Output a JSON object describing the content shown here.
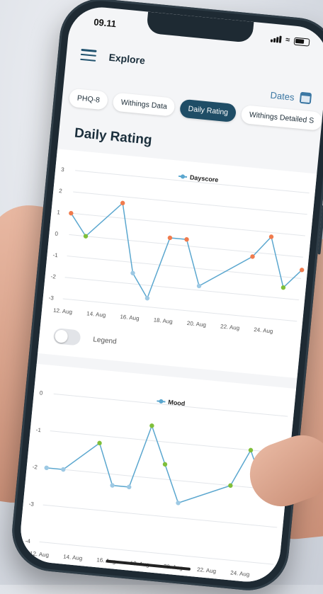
{
  "status": {
    "time": "09.11"
  },
  "header": {
    "title": "Explore",
    "dates_label": "Dates"
  },
  "tabs": [
    "PHQ-8",
    "Withings Data",
    "Daily Rating",
    "Withings Detailed S"
  ],
  "active_tab": "Daily Rating",
  "section_title": "Daily Rating",
  "legend_toggle_label": "Legend",
  "colors": {
    "line": "#5ba7cf",
    "red": "#f07b4d",
    "green": "#7fbf3a",
    "blue": "#9dc9e4",
    "dark": "#1f4d66"
  },
  "chart_data": [
    {
      "type": "line",
      "series": [
        {
          "name": "Dayscore",
          "values": [
            1,
            0,
            1.7,
            -1.5,
            -2.6,
            0.3,
            0.3,
            -1.8,
            -0.2,
            0.8,
            -1.5,
            -0.6
          ],
          "point_colors": [
            "red",
            "green",
            "red",
            "blue",
            "blue",
            "red",
            "red",
            "blue",
            "red",
            "red",
            "green",
            "red"
          ]
        }
      ],
      "x": [
        12,
        13,
        15,
        16,
        17,
        18,
        19,
        20,
        23,
        24,
        25,
        26
      ],
      "xticks": [
        "12. Aug",
        "14. Aug",
        "16. Aug",
        "18. Aug",
        "20. Aug",
        "22. Aug",
        "24. Aug"
      ],
      "yticks": [
        "3",
        "2",
        "1",
        "0",
        "-1",
        "-2",
        "-3"
      ],
      "ylim": [
        -3,
        3
      ]
    },
    {
      "type": "line",
      "series": [
        {
          "name": "Mood",
          "values": [
            -2,
            -2,
            -1.2,
            -2.3,
            -2.3,
            -0.6,
            -1.6,
            -2.6,
            -2,
            -1,
            -2,
            -1.2
          ],
          "point_colors": [
            "blue",
            "blue",
            "green",
            "blue",
            "blue",
            "green",
            "green",
            "blue",
            "green",
            "green",
            "green",
            "green"
          ]
        }
      ],
      "x": [
        12,
        13,
        15,
        16,
        17,
        18,
        19,
        20,
        23,
        24,
        25,
        26
      ],
      "xticks": [
        "12. Aug",
        "14. Aug",
        "16. Aug",
        "18. Aug",
        "20. Aug",
        "22. Aug",
        "24. Aug"
      ],
      "yticks": [
        "0",
        "-1",
        "-2",
        "-3",
        "-4"
      ],
      "ylim": [
        -4,
        0
      ]
    }
  ]
}
